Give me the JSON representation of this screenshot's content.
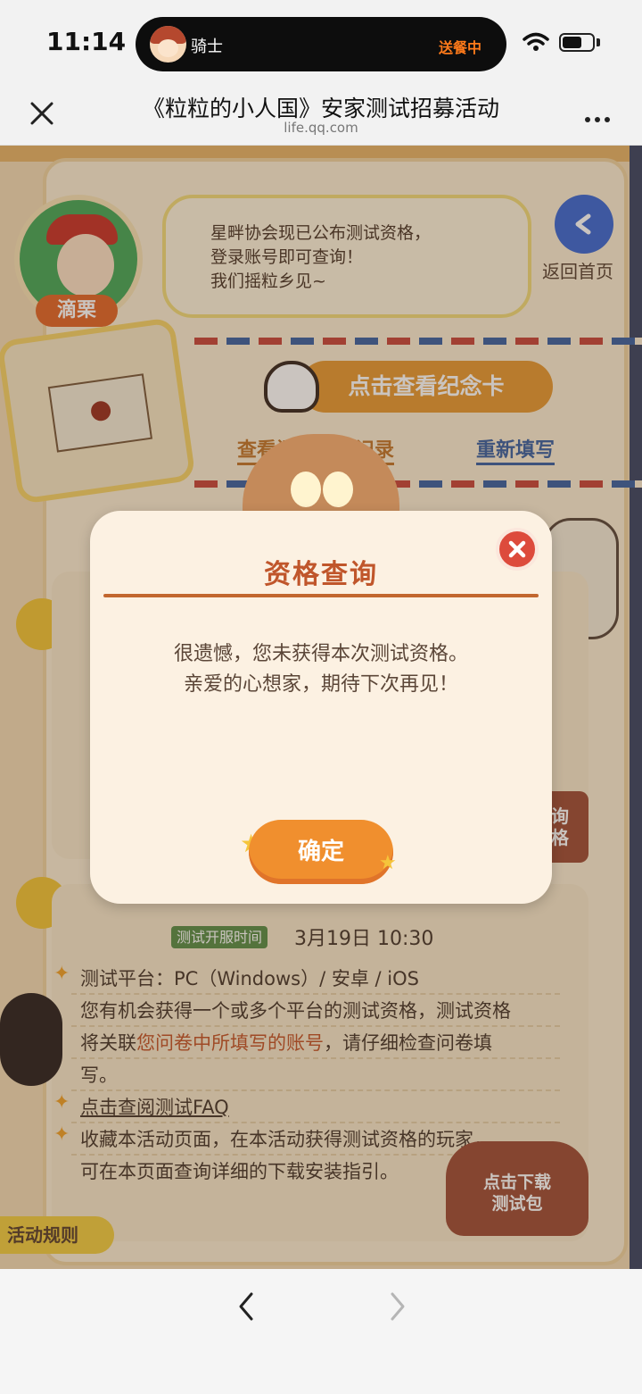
{
  "status_bar": {
    "time": "11:14",
    "island_name": "骑士",
    "island_status": "送餐中"
  },
  "header": {
    "title": "《粒粒的小人国》安家测试招募活动",
    "subtitle": "life.qq.com"
  },
  "page": {
    "character_name": "滴栗",
    "speech": [
      "星畔协会现已公布测试资格，",
      "登录账号即可查询！",
      "我们摇粒乡见~"
    ],
    "home_label": "返回首页",
    "memorial_button": "点击查看纪念卡",
    "record_link": "查看问卷填写记录",
    "refill_link": "重新填写",
    "server_time_label": "测试开服时间",
    "server_time_value": "3月19日 10:30",
    "platform_line": "测试平台：PC（Windows）/ 安卓 / iOS",
    "account_line_1": "您有机会获得一个或多个平台的测试资格，测试资格",
    "account_line_2_pre": "将关联",
    "account_line_2_hl": "您问卷中所填写的账号",
    "account_line_2_post": "，请仔细检查问卷填",
    "account_line_3": "写。",
    "faq_link": "点击查阅测试FAQ",
    "collect_line_1": "收藏本活动页面，在本活动获得测试资格的玩家，",
    "collect_line_2": "可在本页面查询详细的下载安装指引。",
    "rules_tab": "活动规则",
    "download_badge_1": "点击下载",
    "download_badge_2": "测试包",
    "side_badge_1": "询",
    "side_badge_2": "格"
  },
  "modal": {
    "title": "资格查询",
    "message_1": "很遗憾，您未获得本次测试资格。",
    "message_2": "亲爱的心想家，期待下次再见！",
    "confirm": "确定"
  },
  "colors": {
    "accent": "#f08f2e",
    "title_brown": "#c0562b",
    "close_red": "#dd4b3c"
  }
}
